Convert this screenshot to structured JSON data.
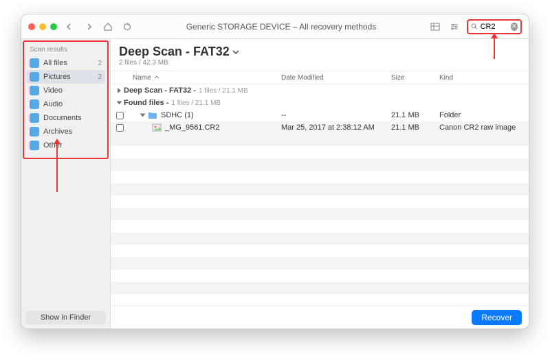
{
  "titlebar": {
    "title": "Generic STORAGE DEVICE – All recovery methods",
    "search_value": "CR2"
  },
  "sidebar": {
    "header": "Scan results",
    "items": [
      {
        "label": "All files",
        "count": "2",
        "color": "#5aa7e6"
      },
      {
        "label": "Pictures",
        "count": "2",
        "color": "#5aa7e6",
        "selected": true
      },
      {
        "label": "Video",
        "count": "",
        "color": "#5aa7e6"
      },
      {
        "label": "Audio",
        "count": "",
        "color": "#5aa7e6"
      },
      {
        "label": "Documents",
        "count": "",
        "color": "#5aa7e6"
      },
      {
        "label": "Archives",
        "count": "",
        "color": "#5aa7e6"
      },
      {
        "label": "Other",
        "count": "",
        "color": "#5aa7e6"
      }
    ],
    "finder_button": "Show in Finder"
  },
  "main": {
    "title": "Deep Scan - FAT32",
    "subtitle": "2 files / 42.3 MB",
    "columns": {
      "name": "Name",
      "date": "Date Modified",
      "size": "Size",
      "kind": "Kind"
    },
    "groups": [
      {
        "label": "Deep Scan - FAT32 -",
        "meta": "1 files / 21.1 MB",
        "open": false
      },
      {
        "label": "Found files -",
        "meta": "1 files / 21.1 MB",
        "open": true
      }
    ],
    "rows": [
      {
        "name": "SDHC (1)",
        "date": "--",
        "size": "21.1 MB",
        "kind": "Folder",
        "indent": 1,
        "icon": "folder",
        "disc": true
      },
      {
        "name": "_MG_9561.CR2",
        "date": "Mar 25, 2017 at 2:38:12 AM",
        "size": "21.1 MB",
        "kind": "Canon CR2 raw image",
        "indent": 2,
        "icon": "image",
        "disc": false
      }
    ],
    "recover_button": "Recover"
  }
}
